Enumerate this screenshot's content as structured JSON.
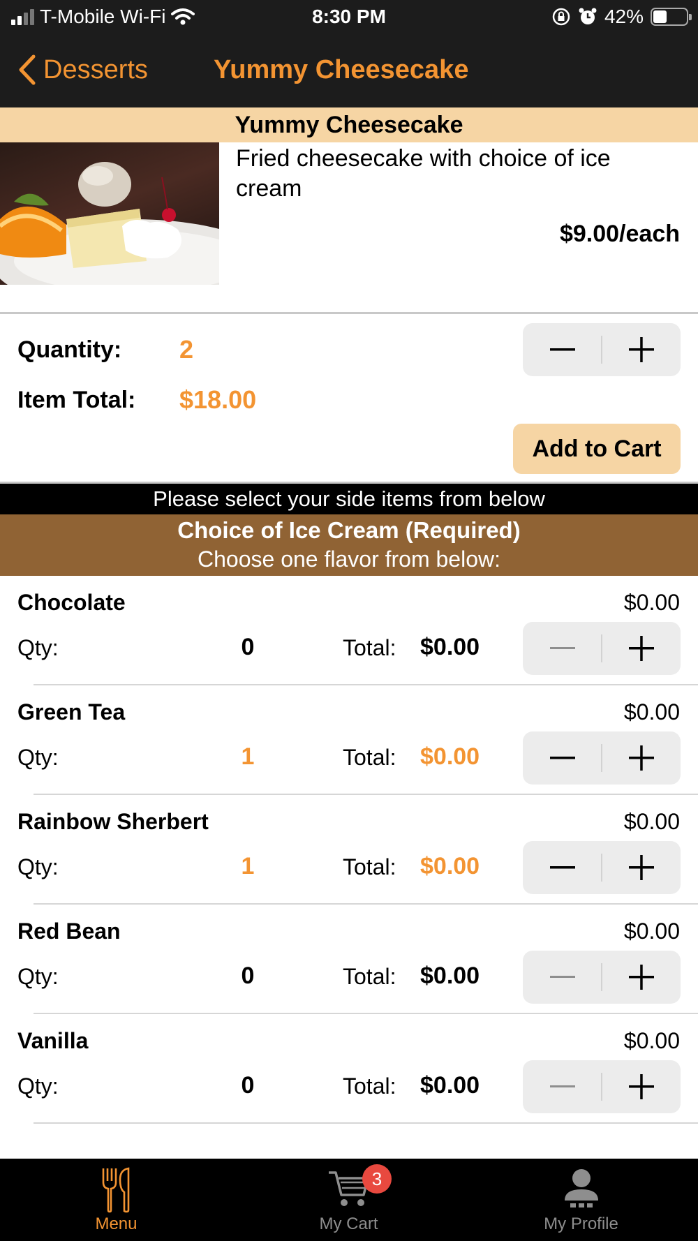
{
  "status_bar": {
    "carrier": "T-Mobile Wi-Fi",
    "time": "8:30 PM",
    "battery": "42%",
    "battery_level": 0.42
  },
  "nav": {
    "back_label": "Desserts",
    "title": "Yummy Cheesecake"
  },
  "item": {
    "name": "Yummy Cheesecake",
    "description": "Fried cheesecake with choice of ice cream",
    "price": "$9.00/each",
    "quantity_label": "Quantity:",
    "quantity": "2",
    "total_label": "Item Total:",
    "total": "$18.00",
    "add_to_cart": "Add to Cart"
  },
  "side_banner": "Please select your side items from below",
  "group": {
    "title": "Choice of Ice Cream (Required)",
    "subtitle": "Choose one flavor from below:"
  },
  "options": [
    {
      "name": "Chocolate",
      "price": "$0.00",
      "qty_label": "Qty:",
      "qty": "0",
      "total_label": "Total:",
      "total": "$0.00",
      "selected": false
    },
    {
      "name": "Green Tea",
      "price": "$0.00",
      "qty_label": "Qty:",
      "qty": "1",
      "total_label": "Total:",
      "total": "$0.00",
      "selected": true
    },
    {
      "name": "Rainbow Sherbert",
      "price": "$0.00",
      "qty_label": "Qty:",
      "qty": "1",
      "total_label": "Total:",
      "total": "$0.00",
      "selected": true
    },
    {
      "name": "Red Bean",
      "price": "$0.00",
      "qty_label": "Qty:",
      "qty": "0",
      "total_label": "Total:",
      "total": "$0.00",
      "selected": false
    },
    {
      "name": "Vanilla",
      "price": "$0.00",
      "qty_label": "Qty:",
      "qty": "0",
      "total_label": "Total:",
      "total": "$0.00",
      "selected": false
    }
  ],
  "tabs": [
    {
      "label": "Menu",
      "icon": "fork-knife-icon",
      "active": true
    },
    {
      "label": "My Cart",
      "icon": "cart-icon",
      "badge": "3",
      "active": false
    },
    {
      "label": "My Profile",
      "icon": "profile-icon",
      "active": false
    }
  ],
  "colors": {
    "accent": "#f39432",
    "header_bg": "#f6d5a4",
    "group_bg": "#906334",
    "bar_bg": "#1c1c1c",
    "badge": "#e8493f"
  }
}
